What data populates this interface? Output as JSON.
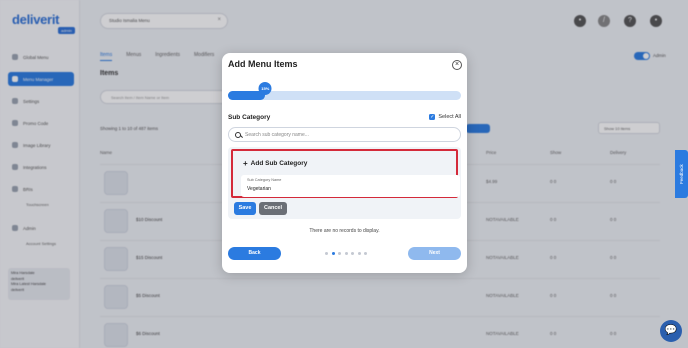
{
  "app": {
    "logo": "deliverit",
    "logo_sub": "admin",
    "business_select": "Studio Ismalia Menu",
    "sidebar": [
      {
        "label": "Global Menu"
      },
      {
        "label": "Menu Manager"
      },
      {
        "label": "Settings"
      },
      {
        "label": "Promo Code"
      },
      {
        "label": "Image Library"
      },
      {
        "label": "Integrations"
      },
      {
        "label": "BRIs"
      },
      {
        "label": "Admin"
      }
    ],
    "sidebar_subs": [
      "Touchscreen",
      "Account Settings"
    ],
    "sidebar_footer": [
      "Mira Harsdale",
      "deliverit",
      "Mira Latest Harsdale",
      "deliverit"
    ],
    "tabs": [
      "Items",
      "Menus",
      "Ingredients",
      "Modifiers"
    ],
    "toggle_label": "Admin",
    "items_title": "Items",
    "search_placeholder": "Search Item / Item Name or Item",
    "showing": "Showing 1 to 10 of 487 items",
    "filter": "Show 10 items",
    "columns": [
      "Name",
      "Price",
      "Show",
      "Delivery"
    ],
    "rows": [
      {
        "name": "",
        "price": "$4.99",
        "show": "0 0",
        "delivery": "0 0"
      },
      {
        "name": "$10 Discount",
        "price": "NOTAVAILABLE",
        "show": "0 0",
        "delivery": "0 0"
      },
      {
        "name": "$15 Discount",
        "price": "NOTAVAILABLE",
        "show": "0 0",
        "delivery": "0 0"
      },
      {
        "name": "$5 Discount",
        "price": "NOTAVAILABLE",
        "show": "0 0",
        "delivery": "0 0"
      },
      {
        "name": "$6 Discount",
        "price": "NOTAVAILABLE",
        "show": "0 0",
        "delivery": "0 0"
      }
    ],
    "feedback": "Feedback"
  },
  "modal": {
    "title": "Add Menu Items",
    "close_icon": "close-icon",
    "progress": {
      "percent": 16,
      "label": "15%"
    },
    "section_label": "Sub Category",
    "select_all_label": "Select All",
    "select_all_checked": true,
    "search_placeholder": "Search sub category name...",
    "add_sub_category_label": "Add Sub Category",
    "name_field_label": "Sub Category Name",
    "name_field_value": "Vegetarian",
    "save_label": "Save",
    "cancel_label": "Cancel",
    "empty_message": "There are no records to display.",
    "back_label": "Back",
    "next_label": "Next",
    "steps": {
      "total": 7,
      "active": 1
    }
  },
  "colors": {
    "primary": "#2b7be0",
    "highlight": "#d42a3a",
    "disabled": "#8fb9ee"
  }
}
